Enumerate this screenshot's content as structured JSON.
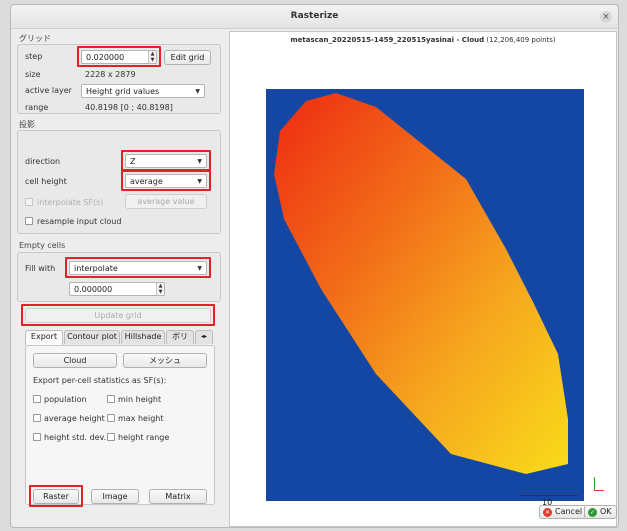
{
  "window": {
    "title": "Rasterize",
    "close": "×"
  },
  "grid": {
    "section_label": "グリッド",
    "step_label": "step",
    "step_value": "0.020000",
    "edit_grid": "Edit grid",
    "size_label": "size",
    "size_value": "2228 x 2879",
    "active_layer_label": "active layer",
    "active_layer_value": "Height grid values",
    "range_label": "range",
    "range_value": "40.8198 [0 ; 40.8198]"
  },
  "projection": {
    "section_label": "投影",
    "direction_label": "direction",
    "direction_value": "Z",
    "cell_height_label": "cell height",
    "cell_height_value": "average",
    "interpolate_sfs_label": "interpolate SF(s)",
    "interpolate_sfs_value": "average value",
    "resample_label": "resample input cloud"
  },
  "empty_cells": {
    "section_label": "Empty cells",
    "fill_with_label": "Fill with",
    "fill_with_value": "interpolate",
    "fill_value": "0.000000"
  },
  "update_grid": "Update grid",
  "tabs": [
    "Export",
    "Contour plot",
    "Hillshade",
    "ボリ"
  ],
  "export": {
    "cloud_button": "Cloud",
    "mesh_button": "メッシュ",
    "stats_label": "Export per-cell statistics as SF(s):",
    "stats": [
      "population",
      "min height",
      "average height",
      "max height",
      "height std. dev.",
      "height range"
    ],
    "raster_button": "Raster",
    "image_button": "Image",
    "matrix_button": "Matrix"
  },
  "viewer": {
    "cloud_name": "metascan_20220515-1459_220515yasinai - Cloud",
    "point_count": " (12,206,409 points)",
    "scale_label": "10"
  },
  "footer": {
    "cancel": "Cancel",
    "ok": "OK"
  },
  "colors": {
    "highlight": "#e5202a",
    "background_plot": "#1347a3",
    "cloud_gradient": [
      "#ee2a12",
      "#f26a18",
      "#f6a51e",
      "#f9dc1a"
    ]
  },
  "icons": [
    "close-icon",
    "spin-arrows-icon",
    "dropdown-arrow-icon",
    "checkbox-icon",
    "tab-scroll-arrows-icon",
    "cancel-icon",
    "ok-icon",
    "axis-trihedron-icon"
  ]
}
